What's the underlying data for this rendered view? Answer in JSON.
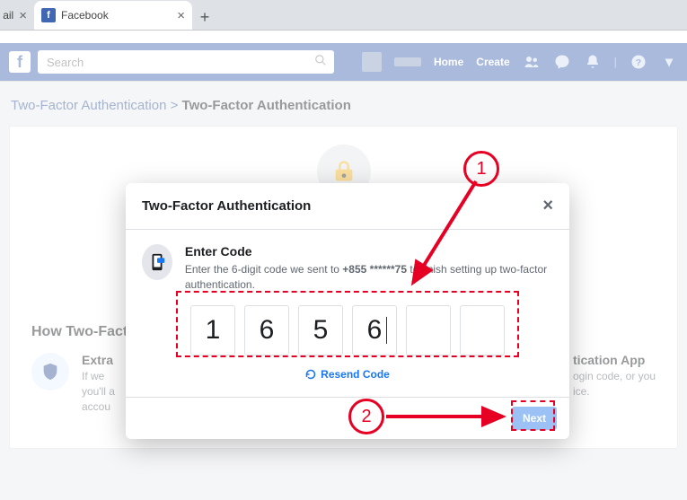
{
  "browser": {
    "tabs": [
      {
        "label": "ail",
        "active": false
      },
      {
        "label": "Facebook",
        "active": true
      }
    ]
  },
  "header": {
    "search_placeholder": "Search",
    "nav": {
      "home": "Home",
      "create": "Create"
    }
  },
  "breadcrumb": {
    "parent": "Two-Factor Authentication",
    "sep": ">",
    "current": "Two-Factor Authentication"
  },
  "card": {
    "how_heading": "How Two-Factor Authentication Works",
    "extra": {
      "title": "Extra",
      "body": "If we\nyou'll a\naccou"
    },
    "app": {
      "title": "tication App",
      "body": "ogin code, or you\nice."
    }
  },
  "modal": {
    "title": "Two-Factor Authentication",
    "close": "×",
    "enter_heading": "Enter Code",
    "enter_sub_1": "Enter the 6-digit code we sent to ",
    "enter_phone": "+855 ******75",
    "enter_sub_2": " to finish setting up two-factor authentication.",
    "code": [
      "1",
      "6",
      "5",
      "6",
      "",
      ""
    ],
    "resend": "Resend Code",
    "next": "Next"
  },
  "annotations": {
    "step1": "1",
    "step2": "2"
  }
}
